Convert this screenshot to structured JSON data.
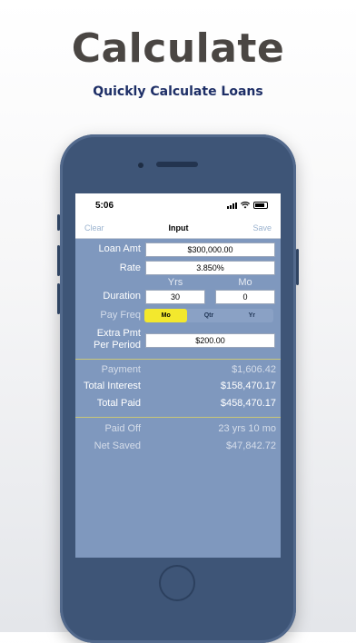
{
  "promo": {
    "headline": "Calculate",
    "subhead": "Quickly Calculate Loans"
  },
  "status": {
    "time": "5:06"
  },
  "nav": {
    "clear": "Clear",
    "title": "Input",
    "save": "Save"
  },
  "form": {
    "loan_amt_label": "Loan Amt",
    "loan_amt_value": "$300,000.00",
    "rate_label": "Rate",
    "rate_value": "3.850%",
    "yrs_header": "Yrs",
    "mo_header": "Mo",
    "duration_label": "Duration",
    "duration_yrs": "30",
    "duration_mo": "0",
    "pay_freq_label": "Pay Freq",
    "pay_freq_options": [
      "Mo",
      "Qtr",
      "Yr"
    ],
    "pay_freq_selected": "Mo",
    "extra_label_1": "Extra Pmt",
    "extra_label_2": "Per Period",
    "extra_value": "$200.00"
  },
  "results": {
    "payment_label": "Payment",
    "payment_value": "$1,606.42",
    "total_interest_label": "Total Interest",
    "total_interest_value": "$158,470.17",
    "total_paid_label": "Total Paid",
    "total_paid_value": "$458,470.17",
    "paid_off_label": "Paid Off",
    "paid_off_value": "23 yrs 10 mo",
    "net_saved_label": "Net Saved",
    "net_saved_value": "$47,842.72"
  },
  "colors": {
    "phone_body": "#3e5577",
    "screen_bg": "#7f98be",
    "segment_selected": "#f3e82d",
    "headline": "#4a4643",
    "subhead": "#1d2e66"
  }
}
